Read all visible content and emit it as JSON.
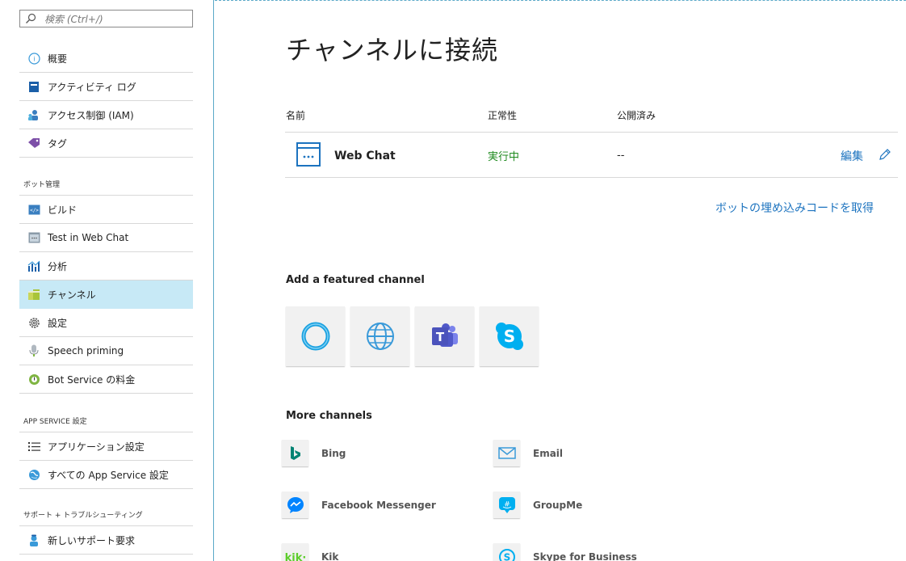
{
  "search": {
    "placeholder": "検索 (Ctrl+/)"
  },
  "sidebar": {
    "items_top": [
      {
        "label": "概要"
      },
      {
        "label": "アクティビティ ログ"
      },
      {
        "label": "アクセス制御 (IAM)"
      },
      {
        "label": "タグ"
      }
    ],
    "section_bot": "ボット管理",
    "items_bot": [
      {
        "label": "ビルド"
      },
      {
        "label": "Test in Web Chat"
      },
      {
        "label": "分析"
      },
      {
        "label": "チャンネル"
      },
      {
        "label": "設定"
      },
      {
        "label": "Speech priming"
      },
      {
        "label": "Bot Service の料金"
      }
    ],
    "section_app": "APP SERVICE 設定",
    "items_app": [
      {
        "label": "アプリケーション設定"
      },
      {
        "label": "すべての App Service 設定"
      }
    ],
    "section_support": "サポート + トラブルシューティング",
    "items_support": [
      {
        "label": "新しいサポート要求"
      }
    ]
  },
  "main": {
    "title": "チャンネルに接続",
    "table": {
      "headers": [
        "名前",
        "正常性",
        "公開済み"
      ],
      "rows": [
        {
          "name": "Web Chat",
          "health": "実行中",
          "published": "--",
          "edit": "編集"
        }
      ]
    },
    "embed_link": "ボットの埋め込みコードを取得",
    "featured_label": "Add a featured channel",
    "featured": [
      "cortana-icon",
      "web-globe-icon",
      "teams-icon",
      "skype-icon"
    ],
    "more_label": "More channels",
    "more_channels": [
      {
        "name": "Bing"
      },
      {
        "name": "Email"
      },
      {
        "name": "Facebook Messenger"
      },
      {
        "name": "GroupMe"
      },
      {
        "name": "Kik"
      },
      {
        "name": "Skype for Business"
      }
    ]
  },
  "colors": {
    "accent": "#1c73bf",
    "active_bg": "#c7e9f6",
    "running": "#1e8a1e"
  }
}
